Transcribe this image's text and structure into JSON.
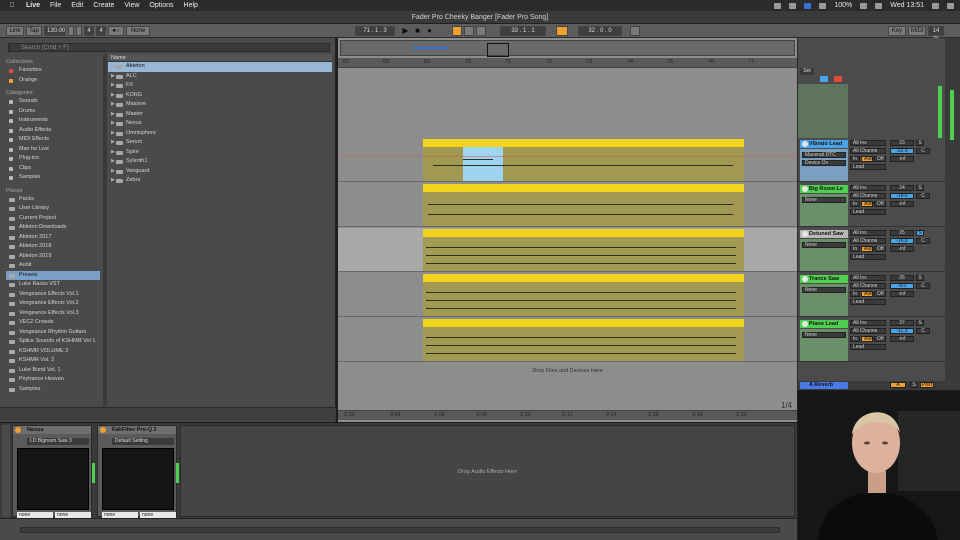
{
  "menubar": {
    "app": "Live",
    "items": [
      "File",
      "Edit",
      "Create",
      "View",
      "Options",
      "Help"
    ],
    "battery": "100%",
    "clock": "Wed 13:51"
  },
  "window": {
    "title": "Fader Pro Cheeky Banger  [Fader Pro Song]"
  },
  "transport": {
    "link": "Link",
    "tap": "Tap",
    "tempo": "130.00",
    "sig_num": "4",
    "sig_den": "4",
    "metronome": "●○",
    "quant": "None",
    "position": "71 .  1 .  3",
    "loop_start": "33 .  1 .  1",
    "loop_len": "32 .  0 .  0",
    "key": "Key",
    "midi": "MIDI",
    "cpu": "14 %"
  },
  "browser": {
    "search_placeholder": "Search (Cmd + F)",
    "collections_title": "Collections",
    "collections": [
      {
        "label": "Favorites",
        "color": "#e24b3b"
      },
      {
        "label": "Orange",
        "color": "#f0a030"
      }
    ],
    "categories_title": "Categories",
    "categories": [
      "Sounds",
      "Drums",
      "Instruments",
      "Audio Effects",
      "MIDI Effects",
      "Max for Live",
      "Plug-ins",
      "Clips",
      "Samples"
    ],
    "places_title": "Places",
    "places": [
      "Packs",
      "User Library",
      "Current Project",
      "Ableton Downloads",
      "Ableton 2017",
      "Ableton 2018",
      "Ableton 2019",
      "Aubit",
      "Presets",
      "Luke Racks VST",
      "Vengeance Effects Vol.1",
      "Vengeance Effects Vol.2",
      "Vengeance Effects Vol.3",
      "VEC2 Crowds",
      "Vengeance Rhythm Guitars",
      "Splice Sounds of KSHMR Vol 1",
      "KSHMR VOLUME 3",
      "KSHMR Vol. 2",
      "Luke Bond Vol. 1",
      "Psytrance Heaven",
      "Samples"
    ],
    "name_header": "Name",
    "names": [
      "Ableton",
      "ALC",
      "FX",
      "KORG",
      "Massive",
      "Master",
      "Nexus",
      "Omnisphere",
      "Serum",
      "Spire",
      "Sylenth1",
      "Vanguard",
      "Zebra"
    ]
  },
  "arrangement": {
    "ruler": [
      "67",
      "68",
      "69",
      "70",
      "71",
      "72",
      "73",
      "74",
      "75",
      "76",
      "77"
    ],
    "bottom_ruler": [
      "2:02",
      "2:04",
      "2:06",
      "2:08",
      "2:10",
      "2:12",
      "2:14",
      "2:16",
      "2:18",
      "2:20"
    ],
    "zoom_label": "1/4",
    "drop_text": "Drop Files and Devices Here"
  },
  "mixer": {
    "set_label": "Set",
    "tracks": [
      {
        "name": "Vibrato Lead",
        "color": "#4aa5e8",
        "num": "23",
        "vol": "-22.9",
        "pan": "C",
        "input": "Macerati DTC",
        "input2": "Device On",
        "out": "Lead"
      },
      {
        "name": "Big Room Le",
        "color": "#4fcf4f",
        "num": "24",
        "vol": "-18.6",
        "pan": "C",
        "input": "None",
        "input2": "",
        "out": "Lead"
      },
      {
        "name": "Detuned Saw",
        "color": "#a8a8a8",
        "num": "25",
        "vol": "-16.0",
        "pan": "C",
        "input": "None",
        "input2": "",
        "out": "Lead"
      },
      {
        "name": "Trance Saw",
        "color": "#4fcf4f",
        "num": "26",
        "vol": "-9.0",
        "pan": "C",
        "input": "None",
        "input2": "",
        "out": "Lead"
      },
      {
        "name": "Piano Lead",
        "color": "#4fcf4f",
        "num": "27",
        "vol": "-11.3",
        "pan": "C",
        "input": "None",
        "input2": "",
        "out": "Lead"
      }
    ],
    "io_in": "All Ins",
    "io_channel": "All Channe",
    "mon_in": "In",
    "mon_auto": "Auto",
    "mon_off": "Off",
    "send_inf": "-inf",
    "solo": "S",
    "return": {
      "name": "A Reverb",
      "letter": "A",
      "solo": "S",
      "post": "Post"
    }
  },
  "devices": [
    {
      "name": "Nexus",
      "preset": "LD Bigroom Saw 3",
      "foot_l": "none",
      "foot_r": "none"
    },
    {
      "name": "FabFilter Pro-Q 2",
      "preset": "Default Setting",
      "foot_l": "none",
      "foot_r": "none"
    }
  ],
  "drop_audio": "Drop Audio Effects Here"
}
